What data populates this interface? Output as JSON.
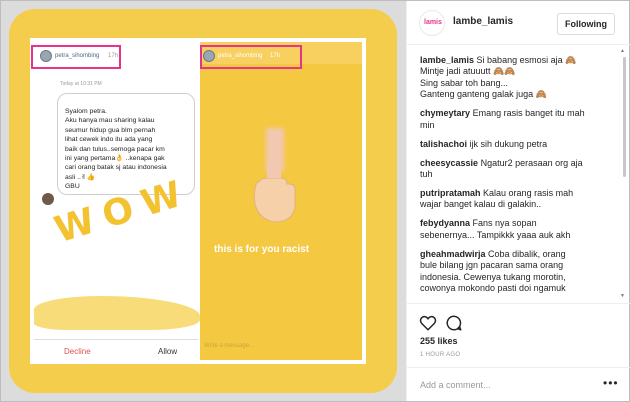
{
  "media": {
    "left_story": {
      "username": "petra_sihombing",
      "time": "17h",
      "date_label": "Today at 10:31 PM",
      "message": "Syalom petra.\nAku hanya mau sharing kalau\nseumur hidup gua blm pernah\nlihat cewek indo itu ada yang\nbaik dan tulus..semoga pacar km\nini yang pertama👌 ..kenapa gak\ncari orang batak sj atau indonesia\nasli ..✌👍\nGBU",
      "overlay_text": "WOW",
      "decline_label": "Decline",
      "allow_label": "Allow"
    },
    "right_story": {
      "username": "petra_sihombing",
      "time": "17h",
      "caption": "this is for you racist",
      "reply_placeholder": "Write a message..."
    },
    "highlight_color": "#e8338a",
    "background_color": "#f4cd4d"
  },
  "header": {
    "handle": "lambe_lamis",
    "logo_text": "lamis",
    "follow_label": "Following"
  },
  "comments": [
    {
      "user": "lambe_lamis",
      "text": "Si babang esmosi aja 🙈\nMintje jadi atuuutt 🙈🙈\nSing sabar toh bang...\nGanteng ganteng galak juga 🙈"
    },
    {
      "user": "chymeytary",
      "text": "Emang rasis banget itu mah\nmin"
    },
    {
      "user": "talishachoi",
      "text": "ijk sih dukung petra"
    },
    {
      "user": "cheesycassie",
      "text": "Ngatur2 perasaan org aja\ntuh"
    },
    {
      "user": "putripratamah",
      "text": "Kalau orang rasis mah\nwajar banget kalau di galakin.."
    },
    {
      "user": "febydyanna",
      "text": "Fans nya sopan\nsebenernya... Tampikkk yaaa auk akh"
    },
    {
      "user": "gheahmadwirja",
      "text": "Coba dibalik, orang\nbule bilang jgn pacaran sama orang\nindonesia. Cewenya tukang morotin,\ncowonya mokondo pasti doi ngamuk\njuga. Racist bgt heran"
    }
  ],
  "actions": {
    "likes": "255 likes",
    "time_ago": "1 HOUR AGO",
    "heart_icon": "heart-outline-icon",
    "comment_icon": "comment-bubble-icon"
  },
  "add_comment": {
    "placeholder": "Add a comment...",
    "more_label": "•••"
  }
}
